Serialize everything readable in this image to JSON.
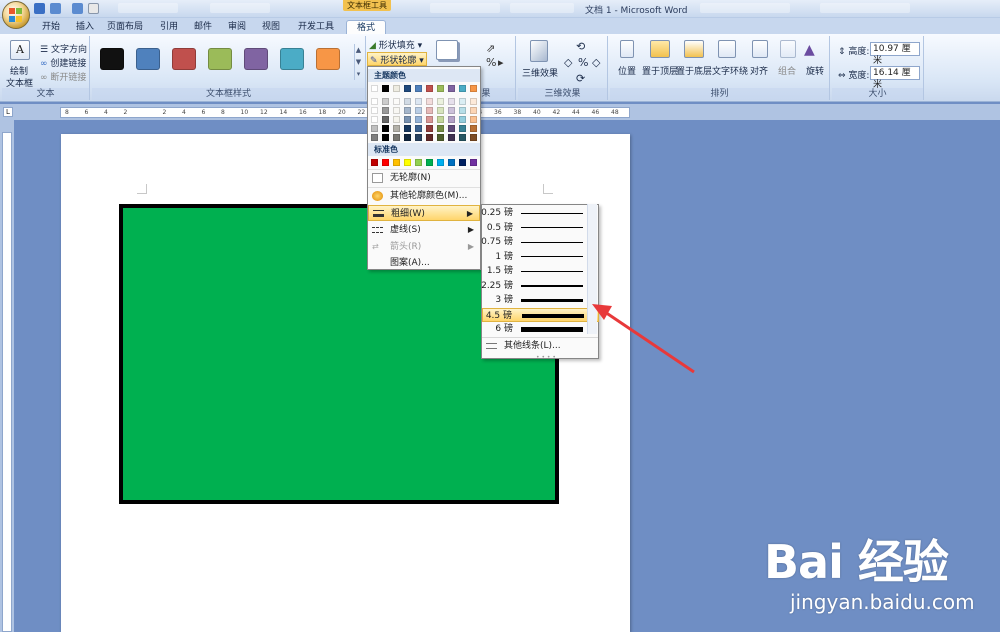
{
  "window": {
    "title": "文档 1 - Microsoft Word",
    "context_tool": "文本框工具"
  },
  "tabs": [
    "开始",
    "插入",
    "页面布局",
    "引用",
    "邮件",
    "审阅",
    "视图",
    "开发工具",
    "格式"
  ],
  "ribbon": {
    "text_group": {
      "label": "文本",
      "draw_textbox": "绘制",
      "draw_textbox_2": "文本框",
      "text_direction": "文字方向",
      "create_link": "创建链接",
      "break_link": "断开链接"
    },
    "styles_group": {
      "label": "文本框样式",
      "swatches": [
        "#111111",
        "#4f81bd",
        "#c0504d",
        "#9bbb59",
        "#8064a2",
        "#4bacc6",
        "#f79646"
      ]
    },
    "shape_fill": "形状填充",
    "shape_outline": "形状轮廓",
    "shadow_group": {
      "label": "阴影效果",
      "btn": "阴影效果"
    },
    "threed_group": {
      "label": "三维效果",
      "btn": "三维效果"
    },
    "arrange_group": {
      "label": "排列",
      "position": "位置",
      "bring_front": "置于顶层",
      "send_back": "置于底层",
      "wrap": "文字环绕",
      "align": "对齐",
      "group": "组合",
      "rotate": "旋转"
    },
    "size_group": {
      "label": "大小",
      "height_label": "高度:",
      "height_value": "10.97 厘米",
      "width_label": "宽度:",
      "width_value": "16.14 厘米"
    }
  },
  "outline_menu": {
    "theme_header": "主题颜色",
    "standard_header": "标准色",
    "standard_colors": [
      "#c00000",
      "#ff0000",
      "#ffc000",
      "#ffff00",
      "#92d050",
      "#00b050",
      "#00b0f0",
      "#0070c0",
      "#002060",
      "#7030a0"
    ],
    "theme_top": [
      "#ffffff",
      "#000000",
      "#eeece1",
      "#1f497d",
      "#4f81bd",
      "#c0504d",
      "#9bbb59",
      "#8064a2",
      "#4bacc6",
      "#f79646"
    ],
    "items": [
      {
        "label": "无轮廓(N)",
        "icon": "no-outline-icon"
      },
      {
        "label": "其他轮廓颜色(M)...",
        "icon": "palette-icon"
      },
      {
        "label": "粗细(W)",
        "icon": "line-weight-icon"
      },
      {
        "label": "虚线(S)",
        "icon": "dash-icon"
      },
      {
        "label": "箭头(R)",
        "icon": "arrow-style-icon"
      },
      {
        "label": "图案(A)...",
        "icon": "pattern-icon"
      }
    ]
  },
  "weight_menu": {
    "options": [
      {
        "label": "0.25 磅",
        "pt": 0.25
      },
      {
        "label": "0.5 磅",
        "pt": 0.5
      },
      {
        "label": "0.75 磅",
        "pt": 0.75
      },
      {
        "label": "1 磅",
        "pt": 1
      },
      {
        "label": "1.5 磅",
        "pt": 1.5
      },
      {
        "label": "2.25 磅",
        "pt": 2.25
      },
      {
        "label": "3 磅",
        "pt": 3
      },
      {
        "label": "4.5 磅",
        "pt": 4.5
      },
      {
        "label": "6 磅",
        "pt": 6
      }
    ],
    "selected": "4.5 磅",
    "more": "其他线条(L)..."
  },
  "ruler_h": [
    "8",
    "6",
    "4",
    "2",
    "",
    "2",
    "4",
    "6",
    "8",
    "10",
    "12",
    "14",
    "16",
    "18",
    "20",
    "22",
    "24",
    "26",
    "28",
    "30",
    "32",
    "34",
    "36",
    "38",
    "40",
    "42",
    "44",
    "46",
    "48"
  ],
  "watermark": {
    "brand": "Bai 经验",
    "url": "jingyan.baidu.com"
  },
  "colors": {
    "shape_fill": "#00b050",
    "shape_border": "#000000",
    "highlight": "#ffd56b",
    "annotation_arrow": "#e8393a"
  }
}
